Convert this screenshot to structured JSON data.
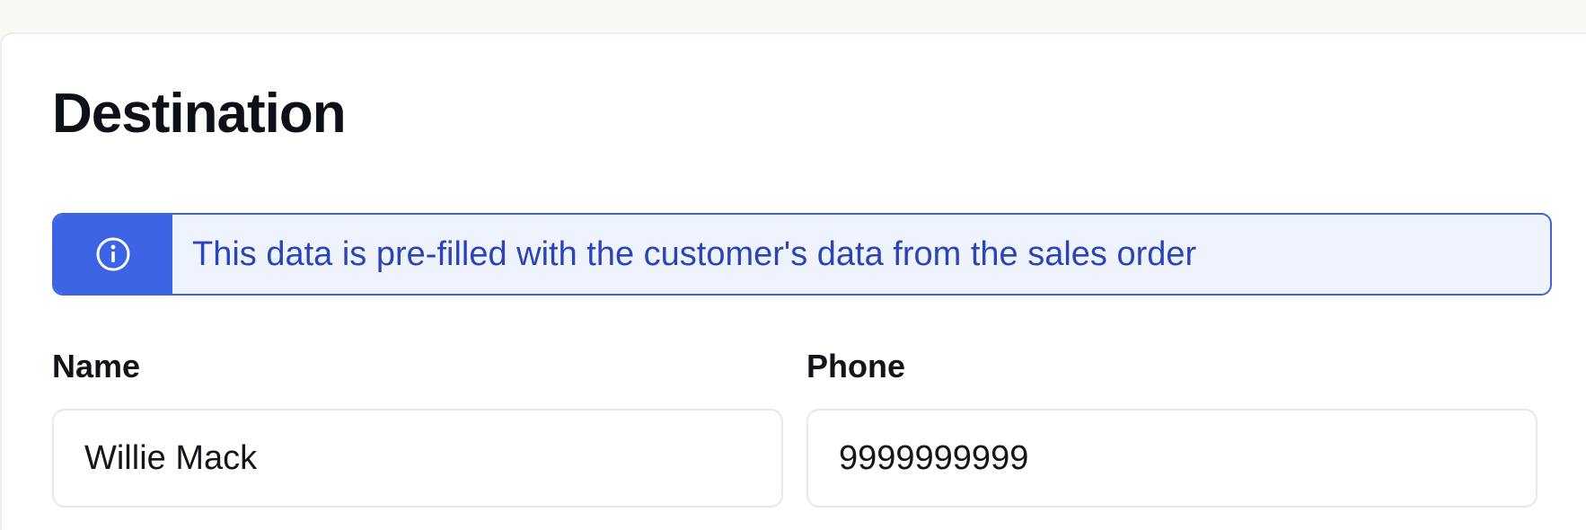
{
  "section": {
    "title": "Destination"
  },
  "notice": {
    "icon": "info-icon",
    "text": "This data is pre-filled with the customer's data from the sales order",
    "accent_color": "#3d64e4",
    "background_color": "#eef3fd",
    "text_color": "#2b45b6"
  },
  "fields": {
    "name": {
      "label": "Name",
      "value": "Willie Mack"
    },
    "phone": {
      "label": "Phone",
      "value": "9999999999"
    }
  }
}
